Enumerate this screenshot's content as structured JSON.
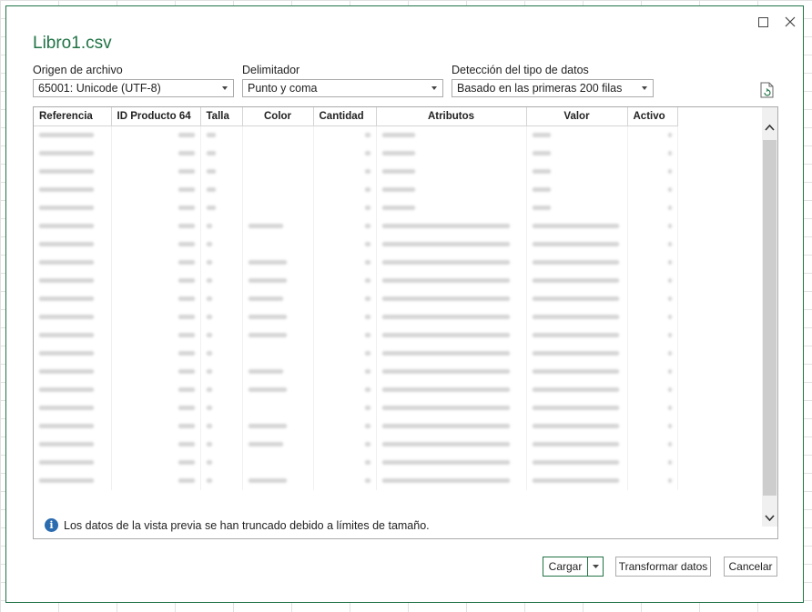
{
  "dialog": {
    "title": "Libro1.csv",
    "maximize_icon": "maximize-icon",
    "close_icon": "close-icon"
  },
  "file_origin": {
    "label": "Origen de archivo",
    "value": "65001: Unicode (UTF-8)"
  },
  "delimiter": {
    "label": "Delimitador",
    "value": "Punto y coma"
  },
  "type_detection": {
    "label": "Detección del tipo de datos",
    "value": "Basado en las primeras 200 filas"
  },
  "refresh_icon": "refresh-icon",
  "preview": {
    "columns": [
      "Referencia",
      "ID Producto 64",
      "Talla",
      "Color",
      "Cantidad",
      "Atributos",
      "Valor",
      "Activo"
    ],
    "row_count": 20,
    "notice": "Los datos de la vista previa se han truncado debido a límites de tamaño."
  },
  "buttons": {
    "load": "Cargar",
    "transform": "Transformar datos",
    "cancel": "Cancelar"
  },
  "colors": {
    "accent": "#217346",
    "info": "#2b6cb0"
  }
}
